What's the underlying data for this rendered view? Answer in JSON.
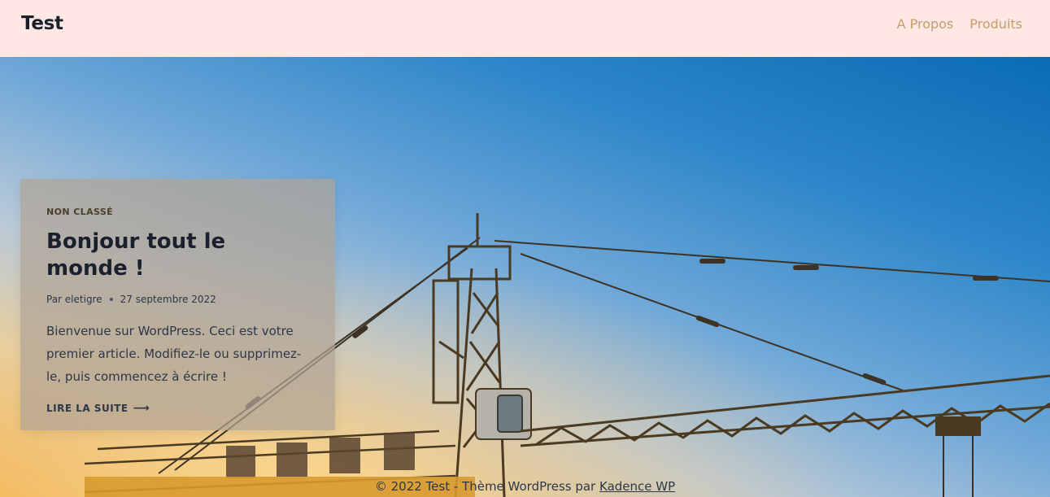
{
  "header": {
    "site_title": "Test",
    "nav": [
      {
        "label": "A Propos"
      },
      {
        "label": "Produits"
      }
    ]
  },
  "post": {
    "category": "NON CLASSÉ",
    "title": "Bonjour tout le monde !",
    "author": "Par eletigre",
    "date": "27 septembre 2022",
    "excerpt": "Bienvenue sur WordPress. Ceci est votre premier article. Modifiez-le ou supprimez-le, puis commencez à écrire !",
    "read_more": "LIRE LA SUITE",
    "read_more_arrow": "⟶"
  },
  "footer": {
    "copyright": "© 2022 Test - Thème WordPress par ",
    "link_label": "Kadence WP"
  },
  "colors": {
    "header_bg": "#ffe8e4",
    "nav_link": "#c69c6d",
    "title": "#1a202c",
    "sky_top": "#0a6bb4",
    "sun_glow": "#f2b24a"
  }
}
